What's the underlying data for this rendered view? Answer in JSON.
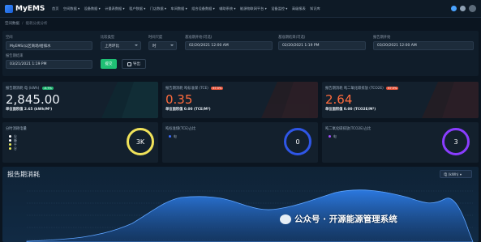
{
  "app": {
    "brand": "MyEMS"
  },
  "nav": {
    "items": [
      "首页",
      "空间数据 ▾",
      "设备数据 ▾",
      "计量表数据 ▾",
      "租户数据 ▾",
      "门店数据 ▾",
      "车间数据 ▾",
      "组合设备数据 ▾",
      "辅助系统 ▾",
      "能源物联网平台 ▾",
      "设备监控 ▾",
      "高级报表",
      "知识库"
    ],
    "right_icons": [
      "gear-icon",
      "notification-icon",
      "user-avatar"
    ]
  },
  "breadcrumb": {
    "parent": "空间数据",
    "current": "能耗分类分析"
  },
  "filters": {
    "space_label": "空间",
    "space_value": "MyEMS/公区商场/给排水",
    "compare_label": "比较类型",
    "compare_value": "上月环比",
    "period_label": "时间尺度",
    "period_value": "时",
    "base_start_label": "基准期开始(可选)",
    "base_start_value": "02/20/2021 12:00 AM",
    "base_end_label": "基准期结束(可选)",
    "base_end_value": "02/20/2021 1:19 PM",
    "report_start_label": "报告期开始",
    "report_start_value": "03/20/2021 12:00 AM",
    "report_end_label": "报告期结束",
    "report_end_value": "03/21/2021 1:19 PM",
    "query_button": "提交",
    "export_button": "导出"
  },
  "kpis": [
    {
      "title": "报告期消耗 电 (kWh)",
      "tag": "-0.7%",
      "value": "2,845.00",
      "sub_label": "单位面积值",
      "sub_value": "2.65 (kWh/M²)",
      "color": "#e9eef4",
      "tag_color": "#22b573"
    },
    {
      "title": "报告期消耗 吨标准煤 (TCE)",
      "tag": "67.5%",
      "value": "0.35",
      "sub_label": "单位面积值",
      "sub_value": "0.00 (TCE/M²)",
      "color": "#ff6b3d",
      "tag_color": "#e8543a"
    },
    {
      "title": "报告期消耗 吨二氧化碳排放 (TCO2E)",
      "tag": "67.5%",
      "value": "2.64",
      "sub_label": "单位面积值",
      "sub_value": "0.00 (TCO2E/M²)",
      "color": "#ff6b3d",
      "tag_color": "#e8543a"
    }
  ],
  "rings": [
    {
      "title": "分时消耗电量",
      "value": "3K",
      "legend": [
        "尖",
        "峰",
        "平",
        "谷"
      ],
      "legend_colors": [
        "#ffffff",
        "#ffffff",
        "#e8e85a",
        "#e8e85a"
      ],
      "ring_color": "#f0e25a"
    },
    {
      "title": "吨标准煤(TCE)占比",
      "value": "0",
      "legend": [
        "电"
      ],
      "legend_colors": [
        "#3b6cff"
      ],
      "ring_color": "#2f56e6"
    },
    {
      "title": "吨二氧化碳排放(TCO2E)占比",
      "value": "3",
      "legend": [
        "电"
      ],
      "legend_colors": [
        "#a44fff"
      ],
      "ring_color": "#8a3dff"
    }
  ],
  "chart": {
    "title": "报告期消耗",
    "unit_select": "电 (kWh) ▾",
    "wave_color": "#1f6fd6"
  },
  "watermark": {
    "text": "公众号 · 开源能源管理系统"
  }
}
